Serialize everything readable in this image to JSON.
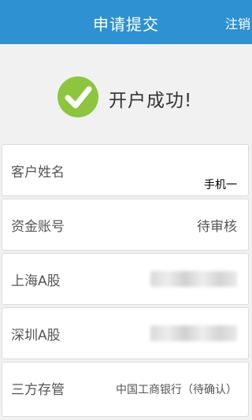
{
  "header": {
    "title": "申请提交",
    "action": "注销"
  },
  "result": {
    "message": "开户成功!",
    "icon": "check-circle-icon",
    "icon_color": "#8cc63e"
  },
  "rows": [
    {
      "label": "客户姓名",
      "value": "手机一"
    },
    {
      "label": "资金账号",
      "value": "待审核"
    },
    {
      "label": "上海A股",
      "value": ""
    },
    {
      "label": "深圳A股",
      "value": ""
    },
    {
      "label": "三方存管",
      "value": "中国工商银行（待确认）"
    }
  ],
  "colors": {
    "header": "#2e91d2",
    "background": "#f1f1f1"
  }
}
